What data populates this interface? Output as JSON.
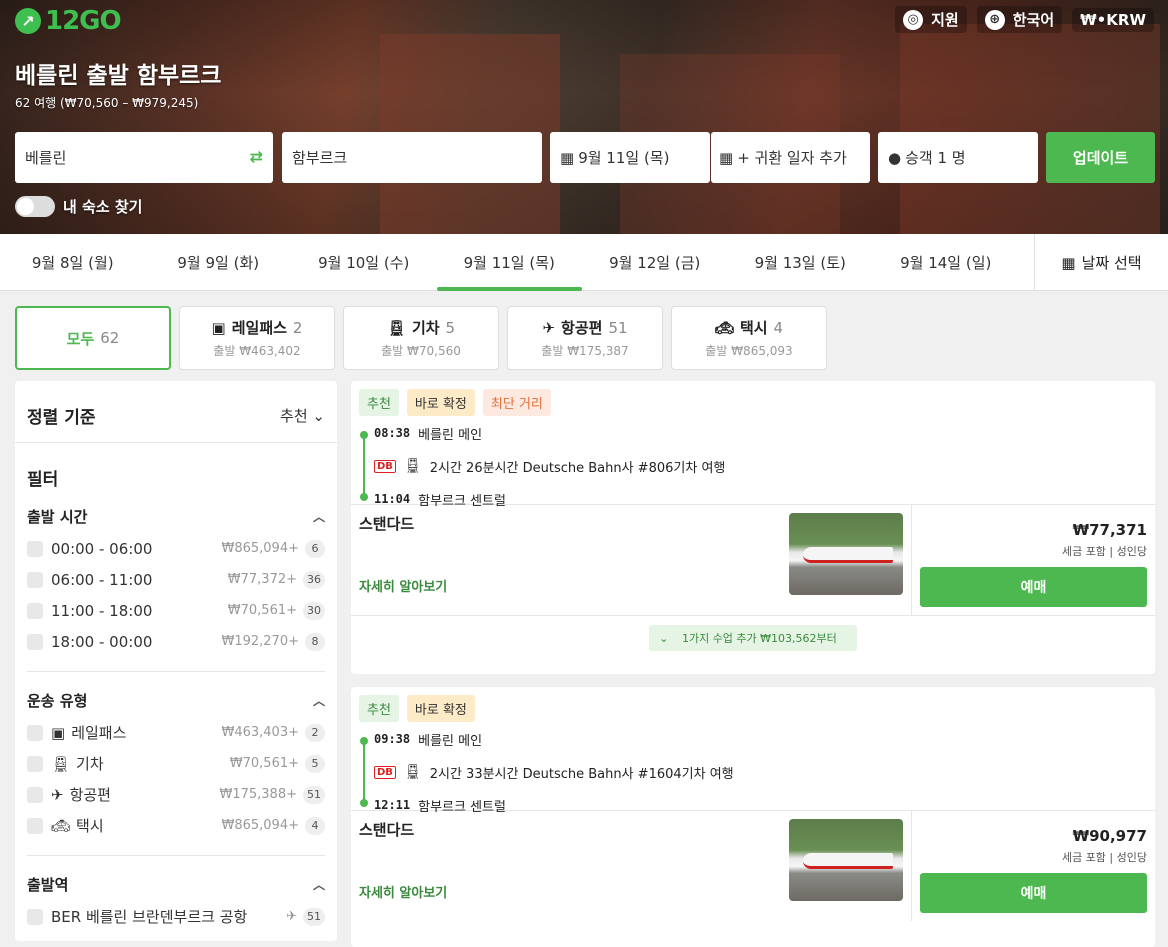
{
  "brand": {
    "logo_text": "12GO",
    "accent": "#4cb84f"
  },
  "topnav": {
    "support": "지원",
    "language": "한국어",
    "currency": "₩•KRW"
  },
  "hero": {
    "title": "베를린 출발 함부르크",
    "subtitle": "62 여행 (₩70,560 – ₩979,245)"
  },
  "search": {
    "from": "베를린",
    "to": "함부르크",
    "date": "9월 11일 (목)",
    "return": "+ 귀환 일자 추가",
    "passengers": "승객 1 명",
    "update": "업데이트"
  },
  "toggle_label": "내 숙소 찾기",
  "dates": [
    "9월 8일 (월)",
    "9월 9일 (화)",
    "9월 10일 (수)",
    "9월 11일 (목)",
    "9월 12일 (금)",
    "9월 13일 (토)",
    "9월 14일 (일)"
  ],
  "date_pick": "날짜 선택",
  "categories": [
    {
      "label": "모두",
      "count": "62",
      "price": ""
    },
    {
      "label": "레일패스",
      "count": "2",
      "price": "출발 ₩463,402"
    },
    {
      "label": "기차",
      "count": "5",
      "price": "출발 ₩70,560"
    },
    {
      "label": "항공편",
      "count": "51",
      "price": "출발 ₩175,387"
    },
    {
      "label": "택시",
      "count": "4",
      "price": "출발 ₩865,093"
    }
  ],
  "sidebar": {
    "sort_label": "정렬 기준",
    "sort_value": "추천",
    "filters_title": "필터",
    "departure_title": "출발 시간",
    "departure": [
      {
        "label": "00:00 - 06:00",
        "price": "₩865,094+",
        "count": "6"
      },
      {
        "label": "06:00 - 11:00",
        "price": "₩77,372+",
        "count": "36"
      },
      {
        "label": "11:00 - 18:00",
        "price": "₩70,561+",
        "count": "30"
      },
      {
        "label": "18:00 - 00:00",
        "price": "₩192,270+",
        "count": "8"
      }
    ],
    "transport_title": "운송 유형",
    "transport": [
      {
        "label": "레일패스",
        "price": "₩463,403+",
        "count": "2"
      },
      {
        "label": "기차",
        "price": "₩70,561+",
        "count": "5"
      },
      {
        "label": "항공편",
        "price": "₩175,388+",
        "count": "51"
      },
      {
        "label": "택시",
        "price": "₩865,094+",
        "count": "4"
      }
    ],
    "station_title": "출발역",
    "station_first": "BER 베를린 브란덴부르크 공항",
    "station_first_count": "51"
  },
  "results": [
    {
      "tags": [
        "추천",
        "바로 확정",
        "최단 거리"
      ],
      "dep_time": "08:38",
      "dep_station": "베를린 메인",
      "duration": "2시간 26분시간 Deutsche Bahn사 #806기차 여행",
      "arr_time": "11:04",
      "arr_station": "함부르크 센트럴",
      "fare_name": "스탠다드",
      "more": "자세히 알아보기",
      "price": "₩77,371",
      "note": "세금 포함 | 성인당",
      "book": "예매",
      "extra": "1가지 수업 추가 ₩103,562부터"
    },
    {
      "tags": [
        "추천",
        "바로 확정"
      ],
      "dep_time": "09:38",
      "dep_station": "베를린 메인",
      "duration": "2시간 33분시간 Deutsche Bahn사 #1604기차 여행",
      "arr_time": "12:11",
      "arr_station": "함부르크 센트럴",
      "fare_name": "스탠다드",
      "more": "자세히 알아보기",
      "price": "₩90,977",
      "note": "세금 포함 | 성인당",
      "book": "예매"
    }
  ],
  "db_logo": "DB"
}
